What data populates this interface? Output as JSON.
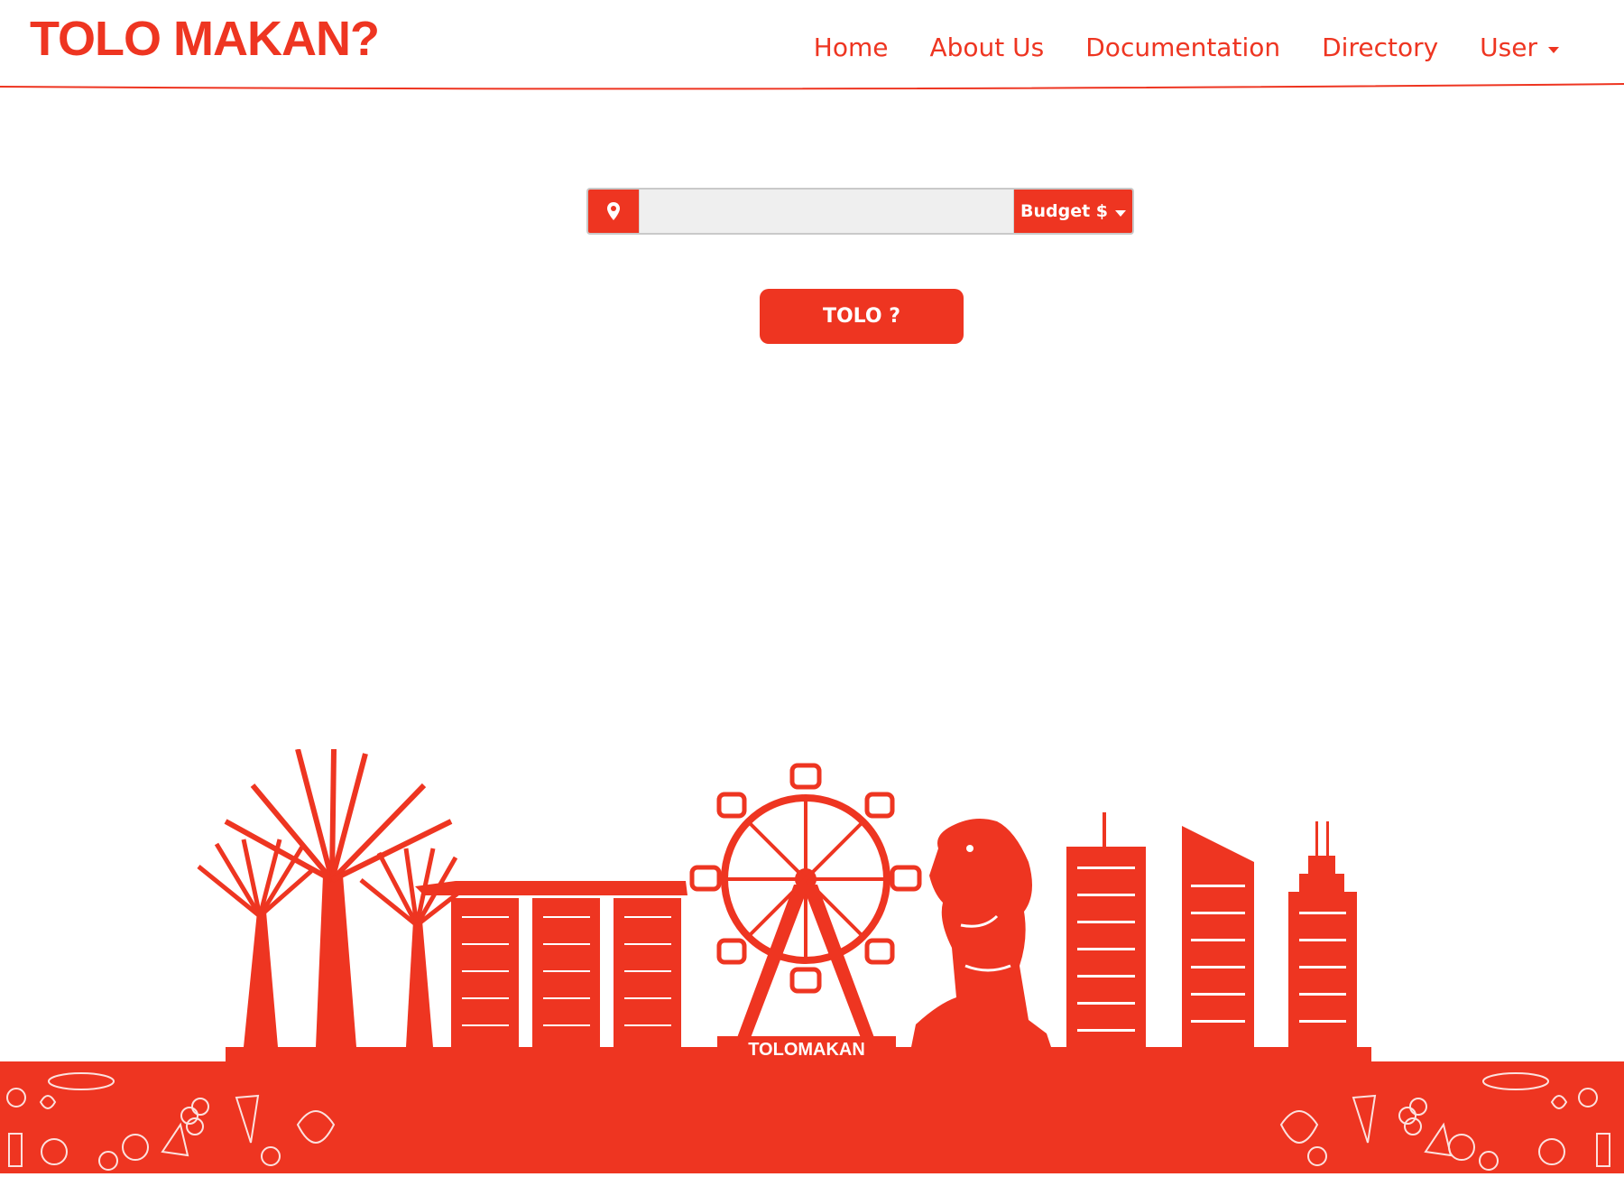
{
  "header": {
    "logo_text": "TOLO MAKAN?",
    "nav": {
      "home": "Home",
      "about": "About Us",
      "documentation": "Documentation",
      "directory": "Directory",
      "user": "User"
    }
  },
  "search": {
    "location_icon": "map-pin-icon",
    "input_value": "",
    "input_placeholder": "",
    "budget_label": "Budget $"
  },
  "actions": {
    "tolo_label": "TOLO ?"
  },
  "illustration": {
    "wheel_sign": "TOLOMAKAN"
  },
  "colors": {
    "accent": "#ee3521",
    "input_bg": "#efefef",
    "background": "#ffffff"
  }
}
